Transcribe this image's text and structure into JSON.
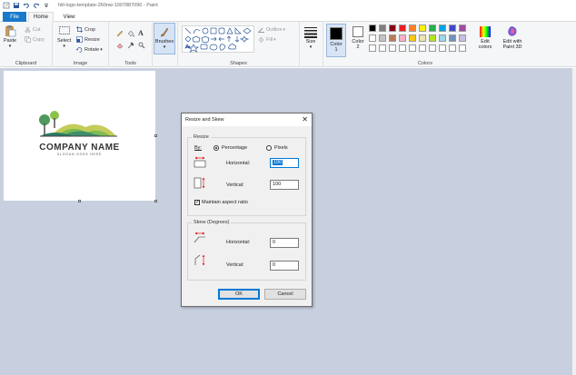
{
  "window": {
    "title": "hill-logo-template-260nw-1007887090 - Paint"
  },
  "tabs": {
    "file": "File",
    "home": "Home",
    "view": "View"
  },
  "ribbon": {
    "clipboard": {
      "label": "Clipboard",
      "paste": "Paste",
      "cut": "Cut",
      "copy": "Copy"
    },
    "image": {
      "label": "Image",
      "select": "Select",
      "crop": "Crop",
      "resize": "Resize",
      "rotate": "Rotate"
    },
    "tools": {
      "label": "Tools"
    },
    "brushes": {
      "label": "Brushes"
    },
    "shapes": {
      "label": "Shapes",
      "outline": "Outline",
      "fill": "Fill"
    },
    "size": {
      "label": "Size"
    },
    "colors": {
      "label": "Colors",
      "color1": "Color",
      "color1_num": "1",
      "color2": "Color",
      "color2_num": "2",
      "edit_colors": "Edit",
      "edit_colors_2": "colors",
      "paint3d": "Edit with",
      "paint3d_2": "Paint 3D"
    },
    "palette_row1": [
      "#000000",
      "#7f7f7f",
      "#880015",
      "#ed1c24",
      "#ff7f27",
      "#fff200",
      "#22b14c",
      "#00a2e8",
      "#3f48cc",
      "#a349a4"
    ],
    "palette_row2": [
      "#ffffff",
      "#c3c3c3",
      "#b97a57",
      "#ffaec9",
      "#ffc90e",
      "#efe4b0",
      "#b5e61d",
      "#99d9ea",
      "#7092be",
      "#c8bfe7"
    ]
  },
  "canvas": {
    "company_name": "COMPANY NAME",
    "slogan": "SLOGAN GOES HERE"
  },
  "dialog": {
    "title": "Resize and Skew",
    "resize_legend": "Resize",
    "by_label": "By:",
    "percentage": "Percentage",
    "pixels": "Pixels",
    "horizontal_label": "Horizontal:",
    "horizontal_value": "100",
    "vertical_label": "Vertical:",
    "vertical_value": "100",
    "maintain_aspect": "Maintain aspect ratio",
    "skew_legend": "Skew (Degrees)",
    "skew_horizontal_label": "Horizontal:",
    "skew_horizontal_value": "0",
    "skew_vertical_label": "Vertical:",
    "skew_vertical_value": "0",
    "ok": "OK",
    "cancel": "Cancel"
  }
}
